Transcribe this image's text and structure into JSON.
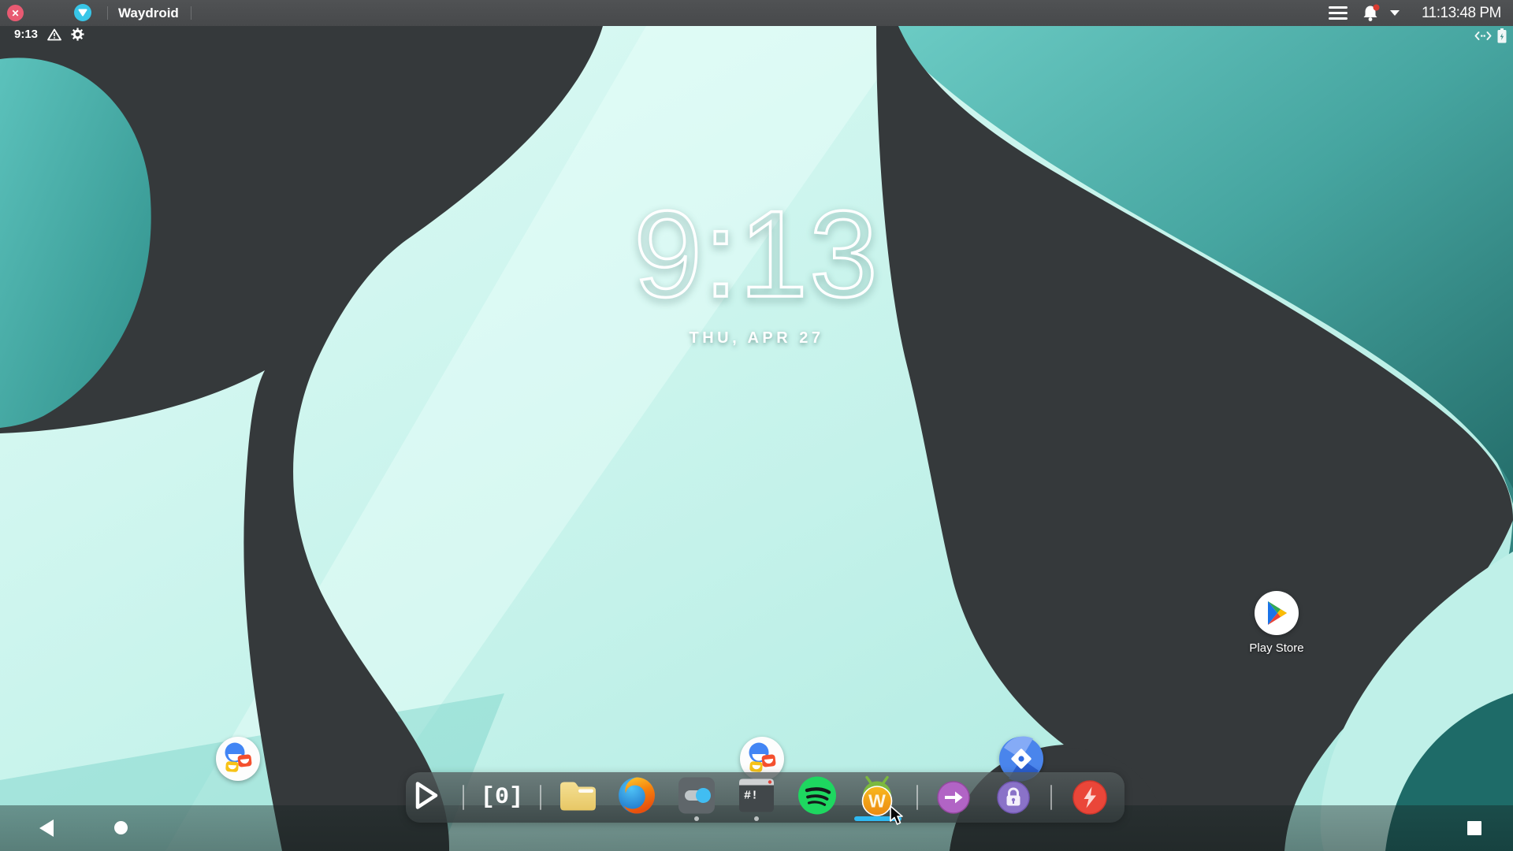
{
  "titlebar": {
    "title": "Waydroid",
    "clock": "11:13:48 PM",
    "icons": [
      "close-icon",
      "waydroid-logo-icon",
      "menu-icon",
      "notifications-bell-icon",
      "dropdown-caret-icon"
    ]
  },
  "android_status_bar": {
    "time": "9:13",
    "left_icons": [
      "warning-icon",
      "settings-gear-icon"
    ],
    "right_icons": [
      "ethernet-icon",
      "battery-charging-icon"
    ]
  },
  "home": {
    "clock": "9:13",
    "date": "THU, APR 27",
    "shortcuts": [
      {
        "icon": "faces-app",
        "label": ""
      },
      {
        "icon": "faces-app",
        "label": ""
      },
      {
        "icon": "aurora-store",
        "label": ""
      },
      {
        "icon": "play-store",
        "label": "Play Store"
      }
    ]
  },
  "dock": {
    "workspace_indicator": "[0]",
    "items": [
      {
        "icon": "launch-play"
      },
      {
        "icon": "workspace-indicator",
        "label": "[0]"
      },
      {
        "icon": "file-manager-folder"
      },
      {
        "icon": "firefox"
      },
      {
        "icon": "toggles-app",
        "running": true
      },
      {
        "icon": "terminal",
        "running": true
      },
      {
        "icon": "spotify"
      },
      {
        "icon": "waydroid-app",
        "active": true
      },
      {
        "icon": "logout-arrow"
      },
      {
        "icon": "lock-screen"
      },
      {
        "icon": "power-bolt"
      }
    ]
  },
  "navigation": {
    "buttons": [
      "back",
      "home",
      "recents"
    ]
  },
  "colors": {
    "titlebar_bg": "#4a4c4e",
    "close_red": "#e85a72",
    "logo_cyan": "#38c6e8",
    "wall_mint": "#cdf6ef",
    "wall_teal": "#3f9e99",
    "wall_charcoal": "#35393b",
    "dock_active_cyan": "#2fb9f2",
    "spotify_green": "#1ed760",
    "power_red": "#ea4639",
    "lock_purple": "#8a72c8",
    "logout_purple": "#b164c5"
  }
}
